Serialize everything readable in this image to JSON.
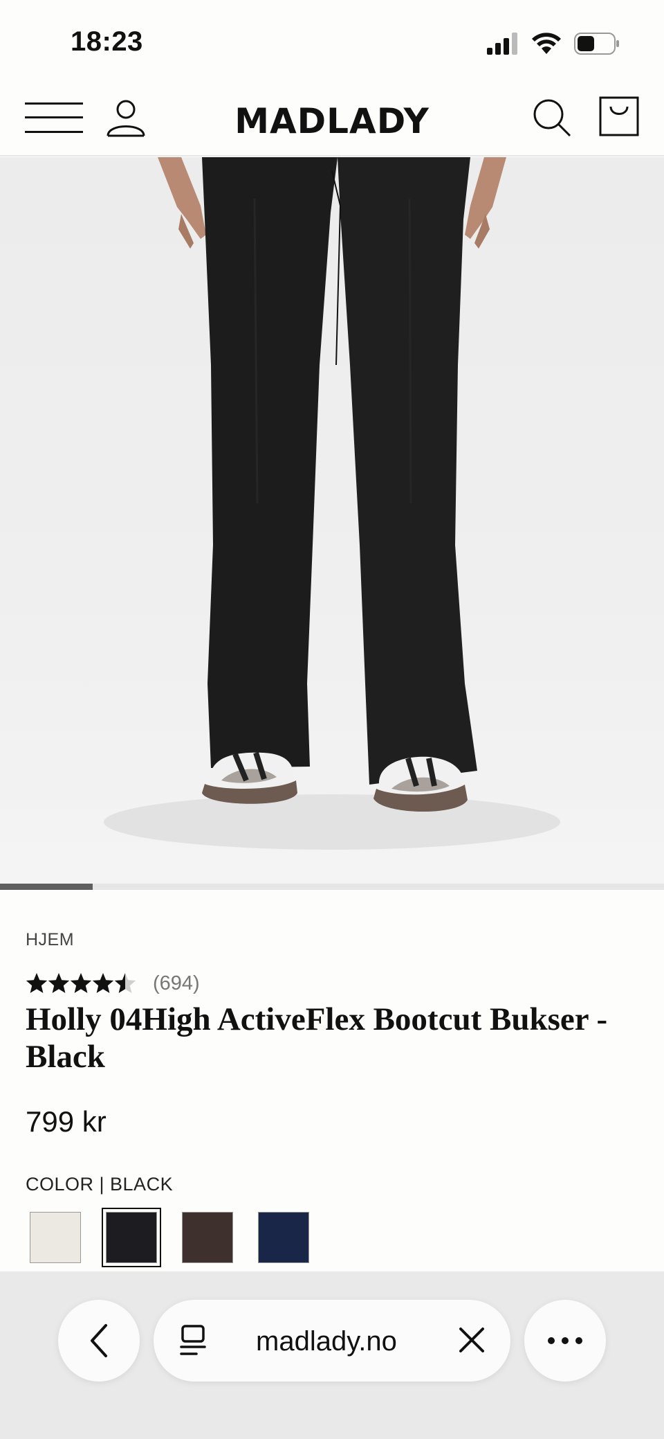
{
  "status_bar": {
    "time": "18:23"
  },
  "header": {
    "logo": "MADLADY"
  },
  "carousel": {
    "progress": 0.14
  },
  "product": {
    "breadcrumb": "HJEM",
    "rating": 4.5,
    "review_count": "(694)",
    "title": "Holly 04High ActiveFlex Bootcut Bukser - Black",
    "price": "799 kr",
    "color_label": "COLOR | BLACK",
    "swatches": [
      {
        "color": "#ece8e2",
        "selected": false
      },
      {
        "color": "#1d1c20",
        "selected": true
      },
      {
        "color": "#3e302c",
        "selected": false
      },
      {
        "color": "#1a2648",
        "selected": false
      }
    ]
  },
  "browser": {
    "url": "madlady.no"
  },
  "colors": {
    "page_bg": "#fdfdfb",
    "browser_bar": "#e9e9e9"
  }
}
